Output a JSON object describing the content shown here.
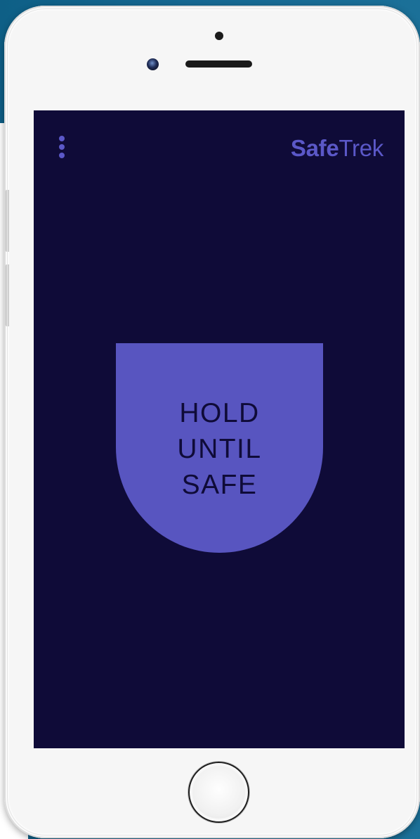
{
  "app": {
    "logo": {
      "bold": "Safe",
      "light": "Trek"
    },
    "hold_button": {
      "lines": [
        "HOLD",
        "UNTIL",
        "SAFE"
      ]
    },
    "icons": {
      "menu": "more-vertical-icon"
    }
  },
  "colors": {
    "screen_background": "#0f0b38",
    "accent": "#5855c0",
    "logo": "#5b58c8",
    "button_text": "#0f0b38",
    "device_frame": "#f6f6f6",
    "backdrop": "#166993"
  }
}
